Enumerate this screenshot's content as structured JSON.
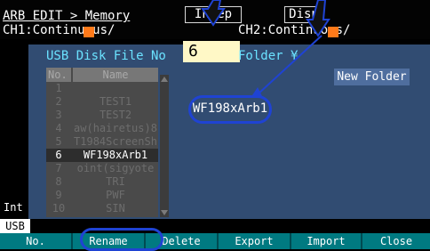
{
  "header": {
    "title": "ARB EDIT > Memory",
    "ch1_label": "CH1:Continuous/",
    "ch2_label": "CH2:Continuous/",
    "indep_button": "Indep",
    "disp_button": "Disp"
  },
  "panel": {
    "usb_disk_file_label": "USB Disk File No",
    "file_number_value": "6",
    "folder_label": "Folder ¥",
    "new_folder_button": "New Folder",
    "selected_file_name": "WF198xArb1"
  },
  "file_list": {
    "columns": [
      "No.",
      "Name"
    ],
    "rows": [
      {
        "no": "1",
        "name": ""
      },
      {
        "no": "2",
        "name": "TEST1"
      },
      {
        "no": "3",
        "name": "TEST2"
      },
      {
        "no": "4",
        "name": "aw(hairetus)8"
      },
      {
        "no": "5",
        "name": "T1984ScreenSh"
      },
      {
        "no": "6",
        "name": "WF198xArb1"
      },
      {
        "no": "7",
        "name": "oint(sigyote"
      },
      {
        "no": "8",
        "name": "TRI"
      },
      {
        "no": "9",
        "name": "PWF"
      },
      {
        "no": "10",
        "name": "SIN"
      }
    ],
    "selected_index": 5
  },
  "sidebar": {
    "int_label": "Int",
    "usb_tab": "USB"
  },
  "bottom_bar": {
    "buttons": [
      "No.",
      "Rename",
      "Delete",
      "Export",
      "Import",
      "Close"
    ]
  },
  "colors": {
    "panel_bg": "#314c72",
    "accent_cyan": "#6be2ff",
    "indicator_orange": "#ff7a1a",
    "annotation_blue": "#1f43d3",
    "bottom_bar_teal": "#007a81"
  }
}
